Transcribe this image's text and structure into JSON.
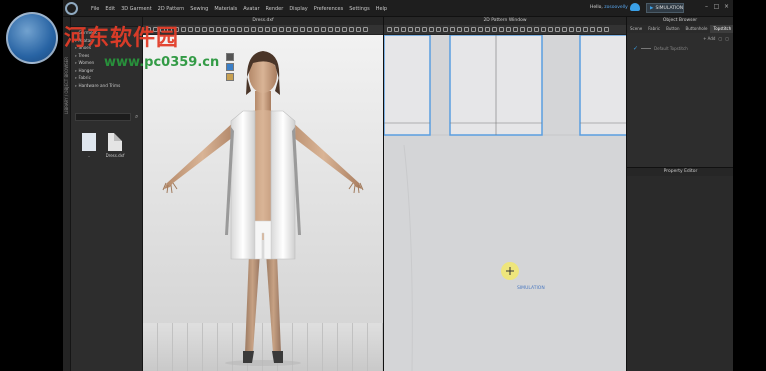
{
  "menubar": {
    "items": [
      "File",
      "Edit",
      "3D Garment",
      "2D Pattern",
      "Sewing",
      "Materials",
      "Avatar",
      "Render",
      "Display",
      "Preferences",
      "Settings",
      "Help"
    ],
    "greeting": "Hello,",
    "username": "zosoovelly",
    "simulation_label": "SIMULATION"
  },
  "library": {
    "side_tab": "LIBRARY / OBJECT BROWSER",
    "tree": [
      "Garment",
      "Avatar",
      "Shoes",
      "Trees",
      "Women",
      "Hanger",
      "Fabric",
      "Hardware and Trims"
    ],
    "files": [
      {
        "label": "..",
        "icon": "folder-icon"
      },
      {
        "label": "Dress.dxf",
        "icon": "file-icon"
      }
    ]
  },
  "viewport3d": {
    "title": "Dress.dxf"
  },
  "viewport2d": {
    "title": "2D Pattern Window",
    "cursor_label": "SIMULATION"
  },
  "object_browser": {
    "title": "Object Browser",
    "tabs": [
      "Scene",
      "Fabric",
      "Button",
      "Buttonhole",
      "Topstitch"
    ],
    "active_tab": "Topstitch",
    "add_label": "+ Add",
    "item": "Default Topstitch"
  },
  "property_editor": {
    "title": "Property Editor"
  },
  "watermark": {
    "cn": "河东软件园",
    "url": "www.pc0359.cn"
  },
  "colors": {
    "pattern_outline": "#4a90d9",
    "accent": "#3aa0e8",
    "watermark_red": "#e13c28",
    "watermark_green": "#28963c"
  }
}
